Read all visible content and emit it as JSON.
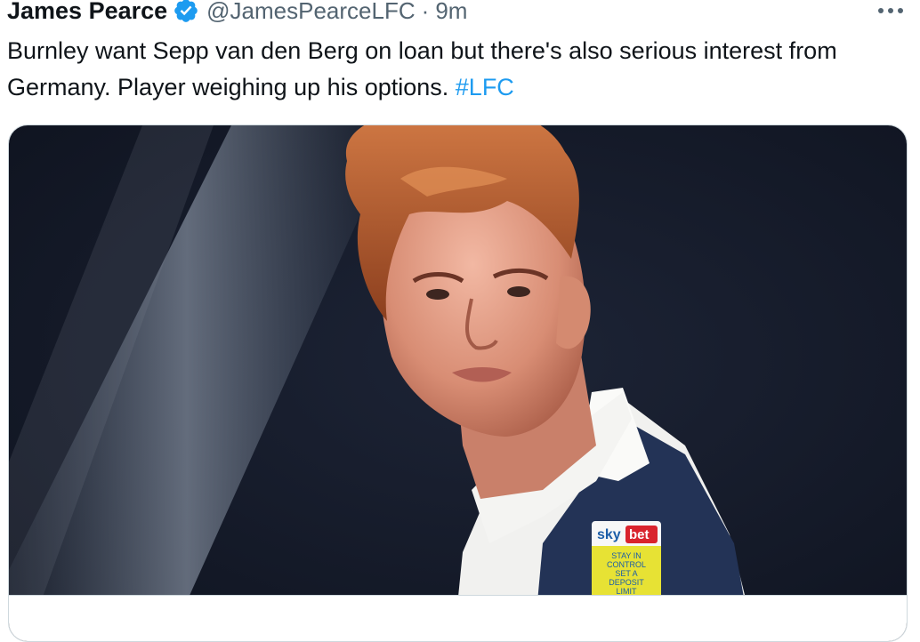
{
  "tweet": {
    "author_name": "James Pearce",
    "handle": "@JamesPearceLFC",
    "separator": "·",
    "time": "9m",
    "text_main": "Burnley want Sepp van den Berg on loan but there's also serious interest from Germany. Player weighing up his options.",
    "hashtag": "#LFC"
  },
  "media": {
    "badge_brand_left": "sky",
    "badge_brand_right": "bet",
    "badge_line1": "STAY IN",
    "badge_line2": "CONTROL",
    "badge_line3": "SET A",
    "badge_line4": "DEPOSIT",
    "badge_line5": "LIMIT"
  },
  "colors": {
    "link": "#1d9bf0",
    "verified": "#1d9bf0",
    "secondary_text": "#536471"
  },
  "icons": [
    "verified-badge-icon",
    "more-options-icon"
  ]
}
